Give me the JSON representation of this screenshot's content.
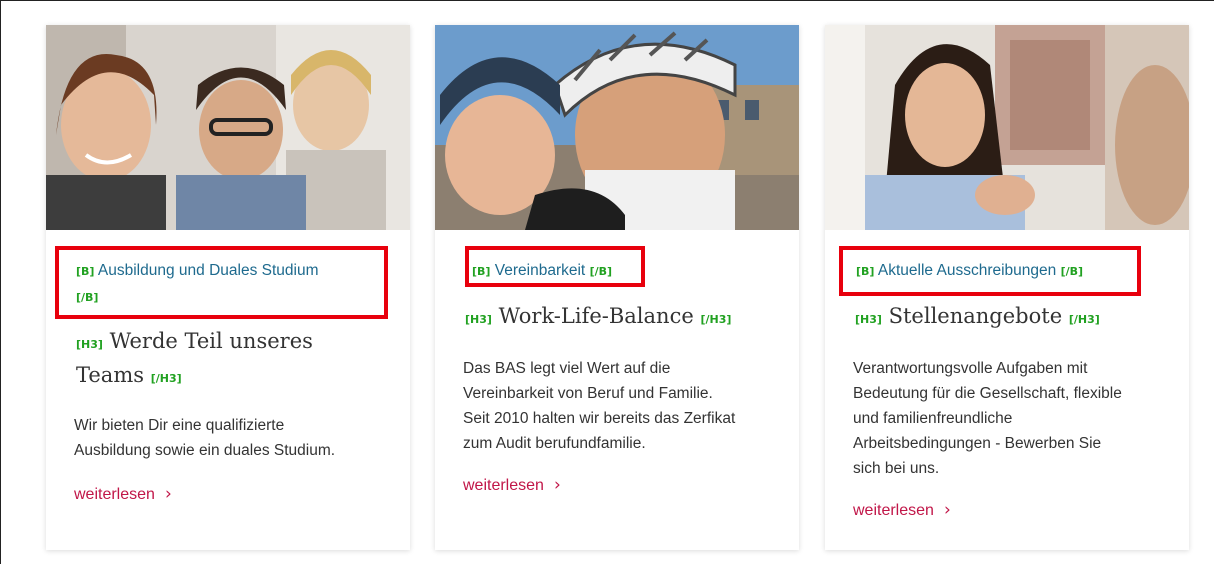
{
  "cards": [
    {
      "tag_open": "[B]",
      "tag_label": "Ausbildung und Duales Studium",
      "tag_close": "[/B]",
      "h3_open": "[H3]",
      "heading_line1": "Werde Teil unseres",
      "heading_line2": "Teams",
      "h3_close": "[/H3]",
      "body_lines": [
        "Wir bieten Dir eine qualifizierte",
        "Ausbildung sowie ein duales Studium."
      ],
      "link": "weiterlesen",
      "chevron": "›"
    },
    {
      "tag_open": "[B]",
      "tag_label": "Vereinbarkeit",
      "tag_close": "[/B]",
      "h3_open": "[H3]",
      "heading_line1": "Work-Life-Balance",
      "h3_close": "[/H3]",
      "body_lines": [
        "Das BAS legt viel Wert auf die",
        "Vereinbarkeit von Beruf und Familie.",
        "Seit 2010 halten wir bereits das Zerfikat",
        "zum Audit berufundfamilie."
      ],
      "link": "weiterlesen",
      "chevron": "›"
    },
    {
      "tag_open": "[B]",
      "tag_label": "Aktuelle Ausschreibungen",
      "tag_close": "[/B]",
      "h3_open": "[H3]",
      "heading_line1": "Stellenangebote",
      "h3_close": "[/H3]",
      "body_lines": [
        "Verantwortungsvolle Aufgaben mit",
        "Bedeutung für die Gesellschaft, flexible",
        "und familienfreundliche",
        "Arbeitsbedingungen - Bewerben Sie",
        "sich bei uns."
      ],
      "link": "weiterlesen",
      "chevron": "›"
    }
  ],
  "colors": {
    "tag_text": "#1e6a8e",
    "markup_code": "#21a121",
    "highlight_box": "#e8000d",
    "link": "#c11648",
    "heading": "#333333"
  }
}
